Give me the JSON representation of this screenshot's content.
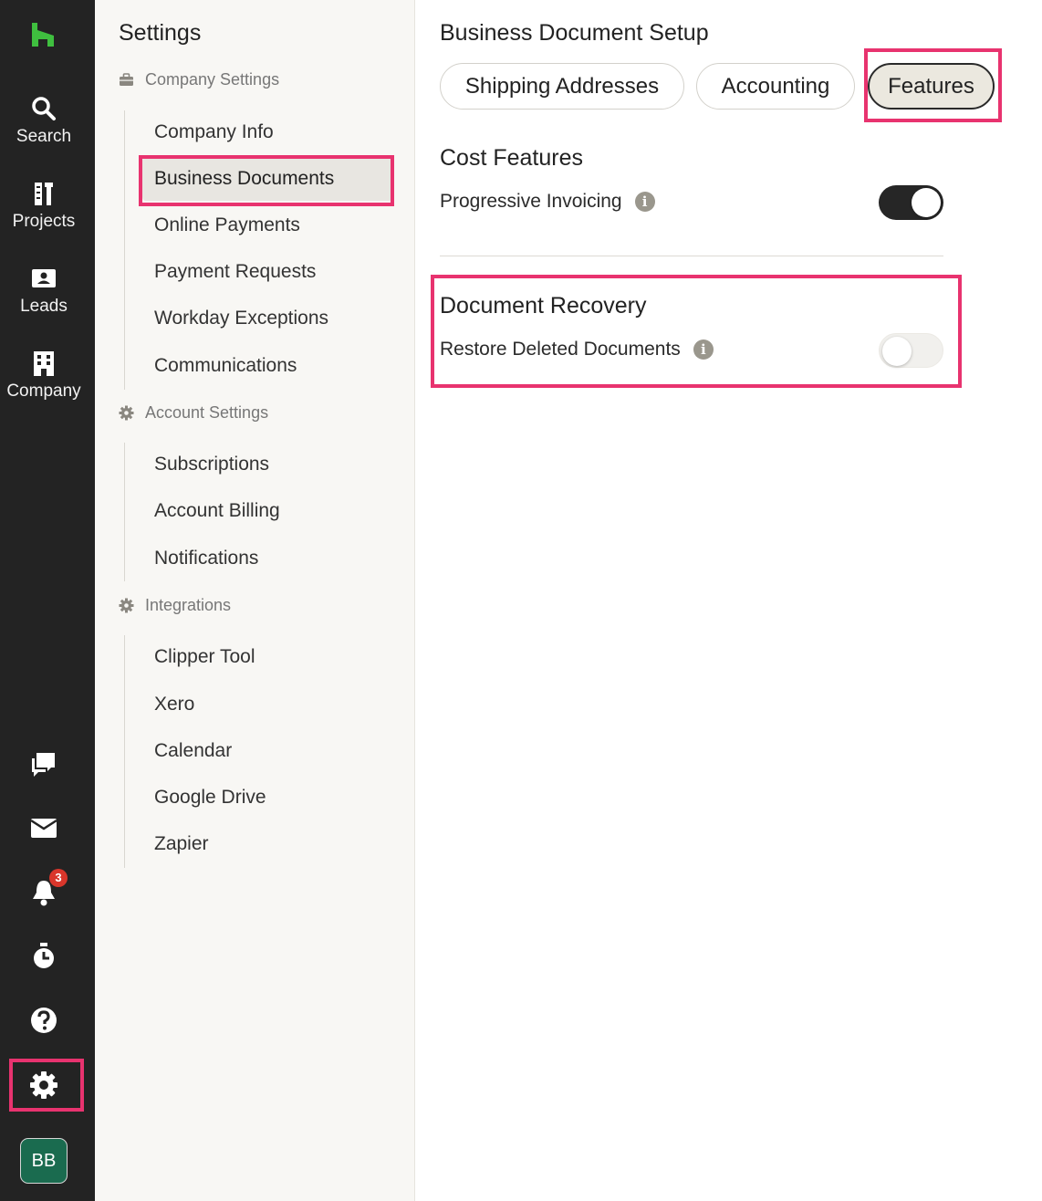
{
  "rail": {
    "items": [
      {
        "label": "Search",
        "icon": "search-icon"
      },
      {
        "label": "Projects",
        "icon": "projects-icon"
      },
      {
        "label": "Leads",
        "icon": "leads-icon"
      },
      {
        "label": "Company",
        "icon": "company-icon"
      }
    ],
    "bottom_icons": [
      "chat-icon",
      "inbox-icon",
      "bell-icon",
      "timer-icon",
      "help-icon",
      "gear-icon"
    ],
    "notification_count": "3",
    "avatar": "BB",
    "brand_color": "#3fbf3f",
    "highlight_color": "#e8336f"
  },
  "settings": {
    "title": "Settings",
    "groups": [
      {
        "label": "Company Settings",
        "icon": "briefcase-icon",
        "items": [
          "Company Info",
          "Business Documents",
          "Online Payments",
          "Payment Requests",
          "Workday Exceptions",
          "Communications"
        ]
      },
      {
        "label": "Account Settings",
        "icon": "gear-icon",
        "items": [
          "Subscriptions",
          "Account Billing",
          "Notifications"
        ]
      },
      {
        "label": "Integrations",
        "icon": "gear-icon",
        "items": [
          "Clipper Tool",
          "Xero",
          "Calendar",
          "Google Drive",
          "Zapier"
        ]
      }
    ],
    "active_item": "Business Documents"
  },
  "main": {
    "title": "Business Document Setup",
    "tabs": [
      "Shipping Addresses",
      "Accounting",
      "Features"
    ],
    "selected_tab": "Features",
    "cost_features": {
      "title": "Cost Features",
      "row_label": "Progressive Invoicing",
      "toggle_on": true
    },
    "document_recovery": {
      "title": "Document Recovery",
      "row_label": "Restore Deleted Documents",
      "toggle_on": false
    },
    "info_glyph": "i"
  }
}
